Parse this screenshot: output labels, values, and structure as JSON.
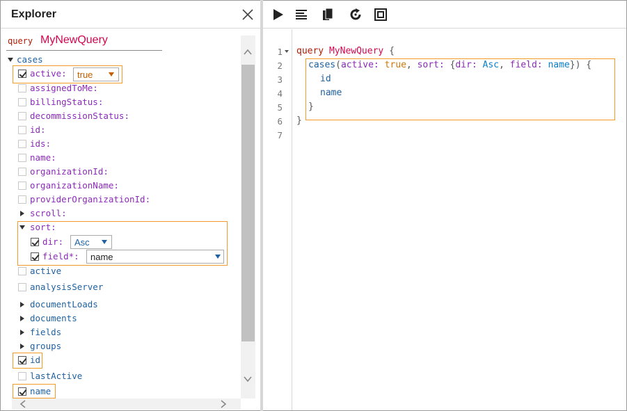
{
  "explorer": {
    "title": "Explorer",
    "query_keyword": "query",
    "query_name": "MyNewQuery",
    "root_field": "cases",
    "args": [
      {
        "label": "active:",
        "checked": true,
        "value": "true"
      },
      {
        "label": "assignedToMe:",
        "checked": false
      },
      {
        "label": "billingStatus:",
        "checked": false
      },
      {
        "label": "decommissionStatus:",
        "checked": false
      },
      {
        "label": "id:",
        "checked": false
      },
      {
        "label": "ids:",
        "checked": false
      },
      {
        "label": "name:",
        "checked": false
      },
      {
        "label": "organizationId:",
        "checked": false
      },
      {
        "label": "organizationName:",
        "checked": false
      },
      {
        "label": "providerOrganizationId:",
        "checked": false
      },
      {
        "label": "scroll:",
        "expandable": true
      },
      {
        "label": "sort:",
        "expanded": true
      }
    ],
    "sort_children": [
      {
        "label": "dir:",
        "checked": true,
        "value": "Asc"
      },
      {
        "label": "field*:",
        "checked": true,
        "value": "name"
      }
    ],
    "fields": [
      {
        "label": "active",
        "checked": false
      },
      {
        "label": "analysisServer",
        "checked": false
      },
      {
        "label": "documentLoads",
        "expandable": true
      },
      {
        "label": "documents",
        "expandable": true
      },
      {
        "label": "fields",
        "expandable": true
      },
      {
        "label": "groups",
        "expandable": true
      },
      {
        "label": "id",
        "checked": true
      },
      {
        "label": "lastActive",
        "checked": false
      },
      {
        "label": "name",
        "checked": true
      }
    ]
  },
  "editor": {
    "line_numbers": [
      "1",
      "2",
      "3",
      "4",
      "5",
      "6",
      "7"
    ],
    "toolbar": [
      "run-icon",
      "prettify-icon",
      "copy-icon",
      "history-icon",
      "explorer-toggle-icon"
    ],
    "lines": [
      {
        "kw": "query",
        "name": "MyNewQuery",
        "brace": "{"
      },
      {
        "field": "cases",
        "open": "(",
        "a1": "active:",
        "v1": "true",
        "comma1": ",",
        "a2": "sort:",
        "ob": "{",
        "a3": "dir:",
        "v3": "Asc",
        "comma2": ",",
        "a4": "field:",
        "v4": "name",
        "cb": "}",
        "close": ")",
        "brace": "{"
      },
      {
        "field": "id"
      },
      {
        "field": "name"
      },
      {
        "brace": "}"
      },
      {
        "brace": "}"
      }
    ]
  },
  "colors": {
    "highlight": "#f39a27",
    "keyword": "#b11a04",
    "def": "#d2054e",
    "field": "#1f61a0",
    "arg": "#8b2bb9"
  }
}
